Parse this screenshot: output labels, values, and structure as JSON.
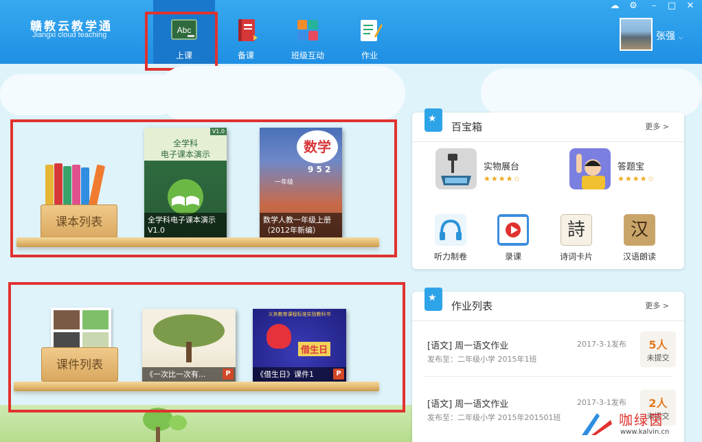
{
  "app": {
    "title_cn": "赣教云教学通",
    "title_en": "Jiangxi cloud teaching"
  },
  "nav": [
    {
      "label": "上课",
      "icon": "chalkboard-abc-icon",
      "icon_text": "Abc",
      "active": true
    },
    {
      "label": "备课",
      "icon": "red-book-icon"
    },
    {
      "label": "班级互动",
      "icon": "colorful-blocks-icon"
    },
    {
      "label": "作业",
      "icon": "pencil-paper-icon"
    }
  ],
  "user": {
    "name": "张强"
  },
  "window_controls": [
    "cloud-icon",
    "settings-icon",
    "minimize-icon",
    "maximize-icon",
    "close-icon"
  ],
  "shelf_textbooks": {
    "label": "课本列表",
    "items": [
      {
        "cover_line1": "全学科",
        "cover_line2": "电子课本演示",
        "badge": "V1.0",
        "caption_line1": "全学科电子课本演示",
        "caption_line2": "V1.0"
      },
      {
        "cover_title": "数学",
        "cover_numbers": "9 5 2",
        "cover_grade": "一年级",
        "caption_line1": "数学人教一年级上册",
        "caption_line2": "（2012年新编）"
      }
    ]
  },
  "shelf_courseware": {
    "label": "课件列表",
    "items": [
      {
        "caption": "《一次比一次有...",
        "badge": "P"
      },
      {
        "cover_header": "义务教育课程标准实验教科书",
        "cover_title": "借生日",
        "caption": "《借生日》课件1",
        "badge": "P"
      }
    ]
  },
  "toolbox": {
    "title": "百宝箱",
    "more": "更多 >",
    "featured": [
      {
        "name": "实物展台",
        "stars": "★★★★☆",
        "icon": "document-camera-icon"
      },
      {
        "name": "答题宝",
        "stars": "★★★★☆",
        "icon": "raised-hand-icon"
      }
    ],
    "tools": [
      {
        "name": "听力制卷",
        "icon": "headphones-icon"
      },
      {
        "name": "录课",
        "icon": "film-record-icon"
      },
      {
        "name": "诗词卡片",
        "icon": "poem-card-icon",
        "glyph": "詩"
      },
      {
        "name": "汉语朗读",
        "icon": "chinese-reading-icon",
        "glyph": "汉"
      }
    ]
  },
  "homework": {
    "title": "作业列表",
    "more": "更多 >",
    "items": [
      {
        "title": "[语文] 周一语文作业",
        "assigned_to": "发布至：二年级小学 2015年1班",
        "date": "2017-3-1发布",
        "count": "5人",
        "status": "未提交"
      },
      {
        "title": "[语文] 周一语文作业",
        "assigned_to": "发布至：二年级小学 2015年201501班",
        "date": "2017-3-1发布",
        "count": "2人",
        "status": "未提交"
      }
    ]
  },
  "watermark": {
    "text_cn": "咖绿茵",
    "url": "www.kalvin.cn"
  },
  "colors": {
    "topbar": "#1f8fe3",
    "highlight_frame": "#e0322f",
    "panel_accent": "#2ea4e8",
    "count_orange": "#e07a1f"
  }
}
